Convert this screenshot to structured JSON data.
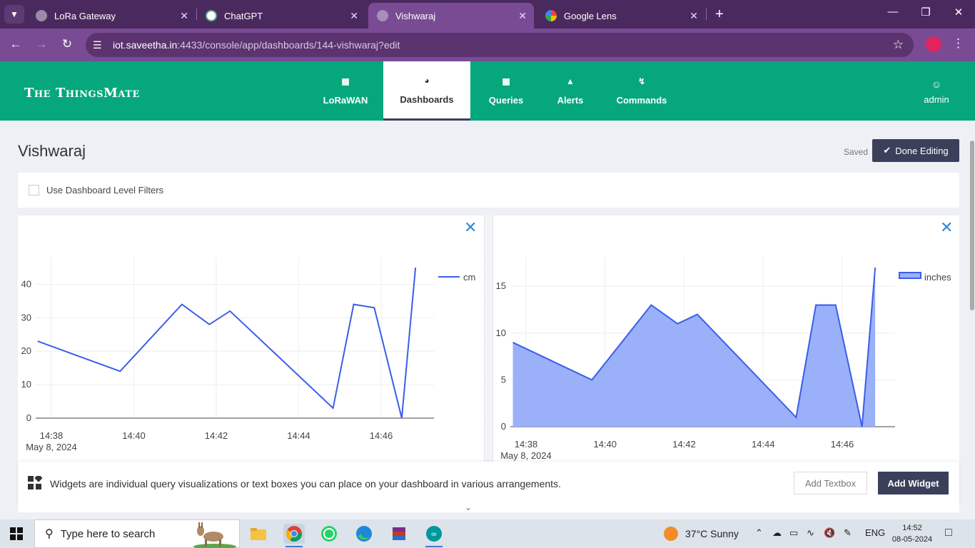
{
  "browser": {
    "tabs": [
      {
        "label": "LoRa Gateway",
        "active": false
      },
      {
        "label": "ChatGPT",
        "active": false
      },
      {
        "label": "Vishwaraj",
        "active": true
      },
      {
        "label": "Google Lens",
        "active": false
      }
    ],
    "url_host": "iot.saveetha.in",
    "url_path": ":4433/console/app/dashboards/144-vishwaraj?edit"
  },
  "app": {
    "logo": "The ThingsMate",
    "nav": [
      {
        "label": "LoRaWAN",
        "icon": "network-icon"
      },
      {
        "label": "Dashboards",
        "icon": "gauge-icon",
        "active": true
      },
      {
        "label": "Queries",
        "icon": "terminal-icon"
      },
      {
        "label": "Alerts",
        "icon": "siren-icon"
      },
      {
        "label": "Commands",
        "icon": "bolt-icon"
      }
    ],
    "user": "admin"
  },
  "dashboard": {
    "title": "Vishwaraj",
    "saved_label": "Saved",
    "done_label": "Done Editing",
    "filters_label": "Use Dashboard Level Filters"
  },
  "footer": {
    "message": "Widgets are individual query visualizations or text boxes you can place on your dashboard in various arrangements.",
    "add_textbox": "Add Textbox",
    "add_widget": "Add Widget"
  },
  "taskbar": {
    "search_placeholder": "Type here to search",
    "weather": "37°C  Sunny",
    "lang": "ENG",
    "time": "14:52",
    "date": "08-05-2024"
  },
  "chart_data": [
    {
      "type": "line",
      "x": [
        "14:37:40",
        "14:39:40",
        "14:41:10",
        "14:41:50",
        "14:42:20",
        "14:44:50",
        "14:45:20",
        "14:45:50",
        "14:46:30",
        "14:46:50"
      ],
      "series": [
        {
          "name": "cm",
          "values": [
            23,
            14,
            34,
            28,
            32,
            3,
            34,
            33,
            0,
            45
          ],
          "color": "#3b5ee8"
        }
      ],
      "x_ticks": [
        "14:38",
        "14:40",
        "14:42",
        "14:44",
        "14:46"
      ],
      "x_date_label": "May 8, 2024",
      "y_ticks": [
        0,
        10,
        20,
        30,
        40
      ],
      "ylim": [
        0,
        45
      ],
      "grid": true,
      "legend": "top-right"
    },
    {
      "type": "area",
      "x": [
        "14:37:40",
        "14:39:40",
        "14:41:10",
        "14:41:50",
        "14:42:20",
        "14:44:50",
        "14:45:20",
        "14:45:50",
        "14:46:30",
        "14:46:50"
      ],
      "series": [
        {
          "name": "inches",
          "values": [
            9,
            5,
            13,
            11,
            12,
            1,
            13,
            13,
            0,
            17
          ],
          "color": "#3b5ee8",
          "fill": "#9ab0f8"
        }
      ],
      "x_ticks": [
        "14:38",
        "14:40",
        "14:42",
        "14:44",
        "14:46"
      ],
      "x_date_label": "May 8, 2024",
      "y_ticks": [
        0,
        5,
        10,
        15
      ],
      "ylim": [
        0,
        17
      ],
      "grid": true,
      "legend": "top-right"
    }
  ]
}
